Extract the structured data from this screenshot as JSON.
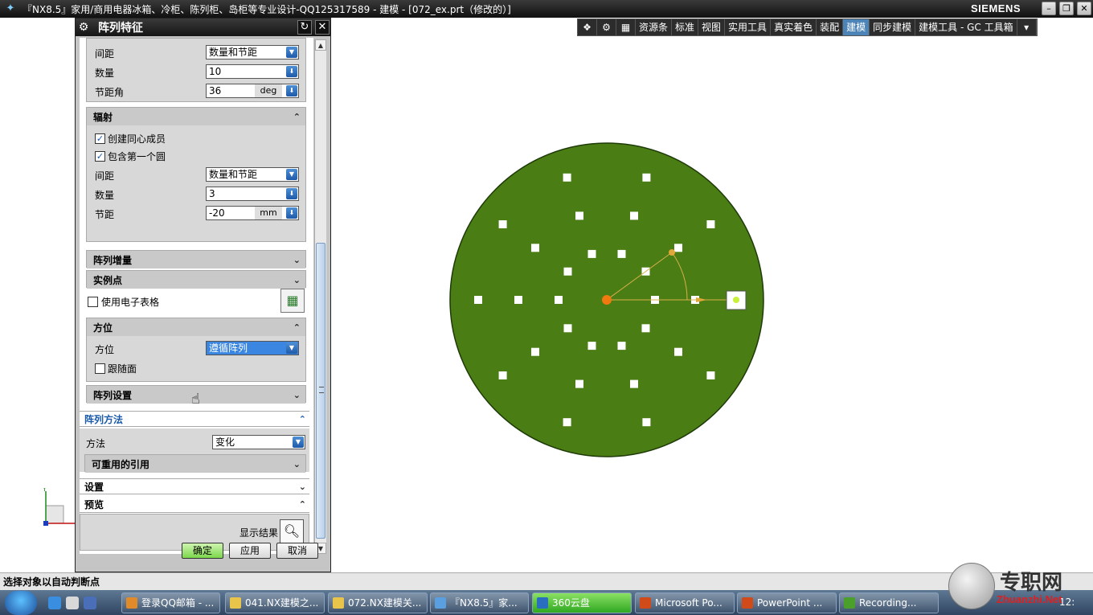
{
  "window": {
    "title": "『NX8.5』家用/商用电器冰箱、冷柜、陈列柜、岛柜等专业设计-QQ125317589 - 建模 - [072_ex.prt（修改的）]",
    "brand": "SIEMENS"
  },
  "toolbar": {
    "items": [
      "资源条",
      "标准",
      "视图",
      "实用工具",
      "真实着色",
      "装配",
      "建模",
      "同步建模",
      "建模工具 - GC 工具箱"
    ],
    "active": "建模"
  },
  "dialog": {
    "title": "阵列特征",
    "angular": {
      "spacing_label": "间距",
      "spacing_value": "数量和节距",
      "count_label": "数量",
      "count_value": "10",
      "pitch_label": "节距角",
      "pitch_value": "36",
      "pitch_unit": "deg"
    },
    "radial": {
      "header": "辐射",
      "create_concentric": "创建同心成员",
      "create_concentric_checked": true,
      "include_first": "包含第一个圆",
      "include_first_checked": true,
      "spacing_label": "间距",
      "spacing_value": "数量和节距",
      "count_label": "数量",
      "count_value": "3",
      "pitch_label": "节距",
      "pitch_value": "-20",
      "pitch_unit": "mm"
    },
    "pattern_increment": "阵列增量",
    "instance_points": "实例点",
    "use_spreadsheet": "使用电子表格",
    "orientation": {
      "header": "方位",
      "label": "方位",
      "value": "遵循阵列",
      "follow_face": "跟随面"
    },
    "pattern_settings": "阵列设置",
    "pattern_method": {
      "header": "阵列方法",
      "method_label": "方法",
      "method_value": "变化",
      "reusable_refs": "可重用的引用"
    },
    "settings": "设置",
    "preview": {
      "header": "预览",
      "show_result": "显示结果"
    },
    "buttons": {
      "ok": "确定",
      "apply": "应用",
      "cancel": "取消"
    }
  },
  "status": {
    "text": "选择对象以自动判断点"
  },
  "taskbar": {
    "items": [
      "登录QQ邮箱 - ...",
      "041.NX建模之...",
      "072.NX建模关...",
      "『NX8.5』家...",
      "360云盘",
      "Microsoft Po...",
      "PowerPoint ...",
      "Recording..."
    ],
    "clock": "12:"
  },
  "watermark": {
    "text": "专职网",
    "url": "Zhuanzhi.Net"
  },
  "axes": {
    "y": "Y",
    "x": "X"
  },
  "colors": {
    "disk": "#4a7d14",
    "hole": "#ffffff",
    "accent": "#1a5aa8",
    "primary_button": "#7cd84c"
  }
}
